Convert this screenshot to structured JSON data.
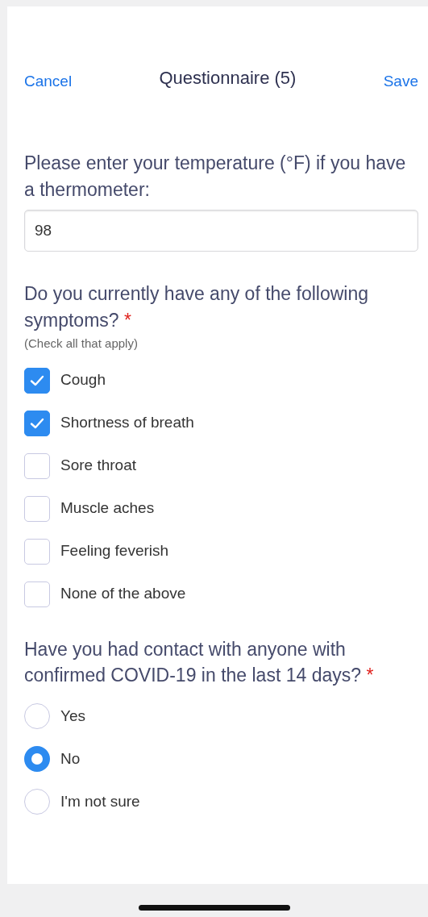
{
  "header": {
    "cancel": "Cancel",
    "title": "Questionnaire (5)",
    "save": "Save"
  },
  "questions": [
    {
      "kind": "text",
      "text": "Please enter your temperature (°F) if you have a thermometer:",
      "value": "98"
    },
    {
      "kind": "checkbox",
      "text": "Do you currently have any of the following symptoms?",
      "required_mark": "*",
      "hint": "(Check all that apply)",
      "options": [
        {
          "label": "Cough",
          "checked": true
        },
        {
          "label": "Shortness of breath",
          "checked": true
        },
        {
          "label": "Sore throat",
          "checked": false
        },
        {
          "label": "Muscle aches",
          "checked": false
        },
        {
          "label": "Feeling feverish",
          "checked": false
        },
        {
          "label": "None of the above",
          "checked": false
        }
      ]
    },
    {
      "kind": "radio",
      "text": "Have you had contact with anyone with confirmed COVID-19 in the last 14 days?",
      "required_mark": "*",
      "options": [
        {
          "label": "Yes",
          "selected": false
        },
        {
          "label": "No",
          "selected": true
        },
        {
          "label": "I'm not sure",
          "selected": false
        }
      ]
    }
  ]
}
